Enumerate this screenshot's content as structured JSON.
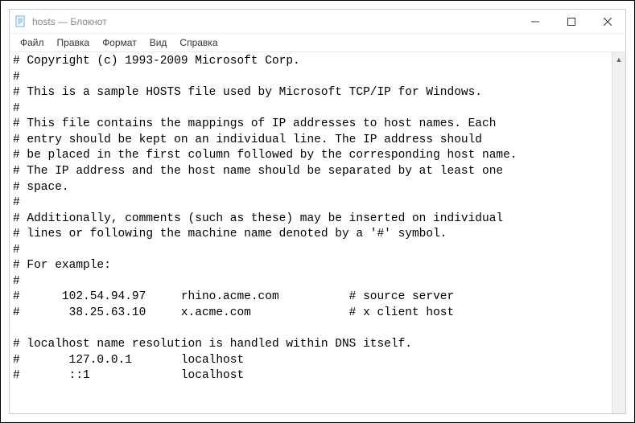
{
  "window": {
    "title": "hosts — Блокнот"
  },
  "menu": {
    "file": "Файл",
    "edit": "Правка",
    "format": "Формат",
    "view": "Вид",
    "help": "Справка"
  },
  "content": "# Copyright (c) 1993-2009 Microsoft Corp.\n#\n# This is a sample HOSTS file used by Microsoft TCP/IP for Windows.\n#\n# This file contains the mappings of IP addresses to host names. Each\n# entry should be kept on an individual line. The IP address should\n# be placed in the first column followed by the corresponding host name.\n# The IP address and the host name should be separated by at least one\n# space.\n#\n# Additionally, comments (such as these) may be inserted on individual\n# lines or following the machine name denoted by a '#' symbol.\n#\n# For example:\n#\n#      102.54.94.97     rhino.acme.com          # source server\n#       38.25.63.10     x.acme.com              # x client host\n\n# localhost name resolution is handled within DNS itself.\n#       127.0.0.1       localhost\n#       ::1             localhost"
}
